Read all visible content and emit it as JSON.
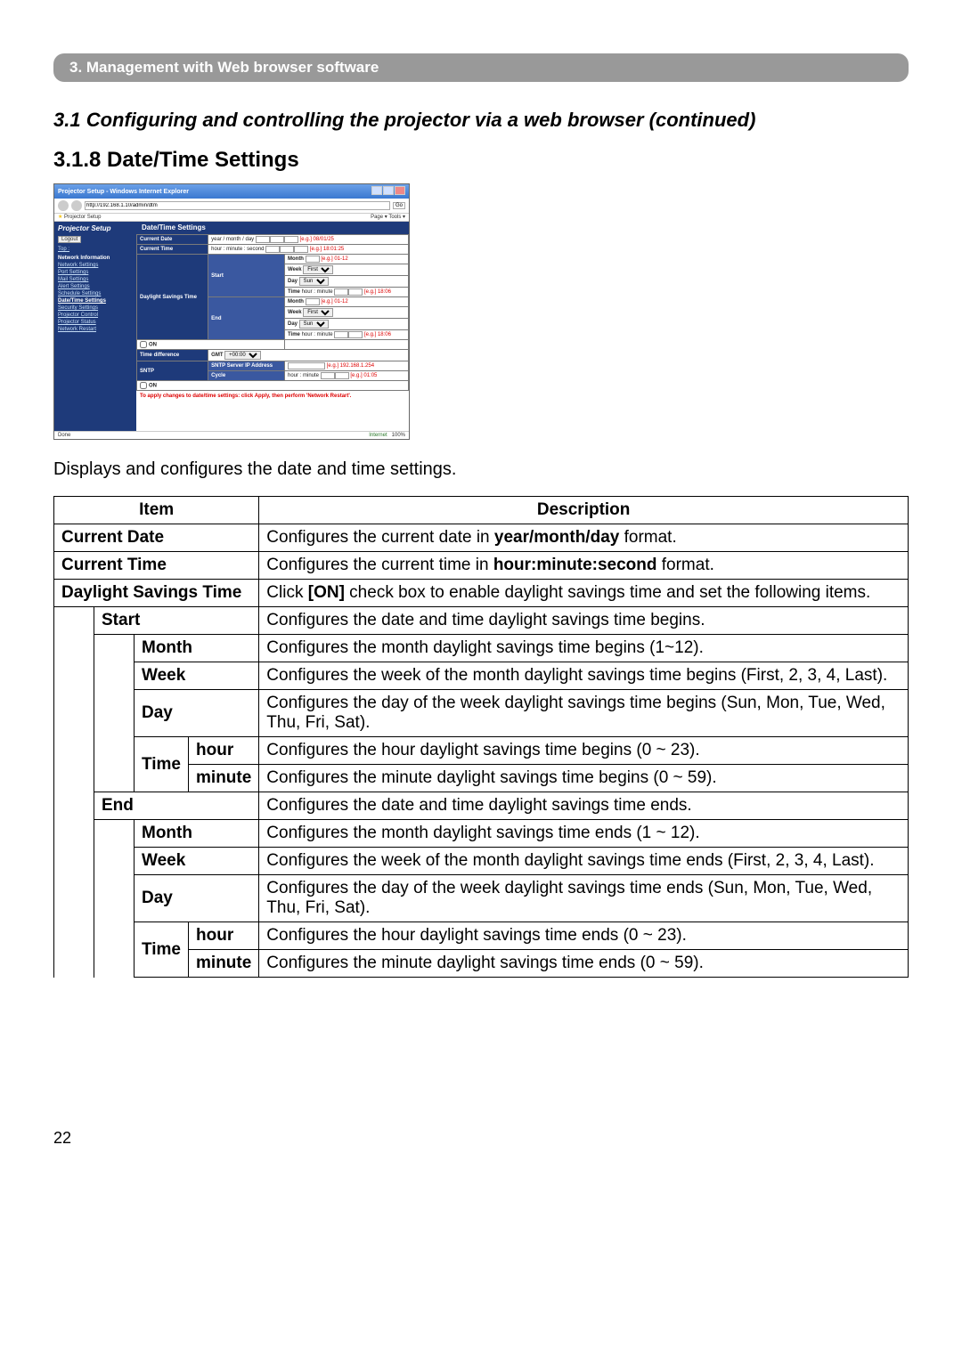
{
  "chapter": "3. Management with Web browser software",
  "section": "3.1 Configuring and controlling the projector via a web browser (continued)",
  "subsection": "3.1.8 Date/Time Settings",
  "intro": "Displays and configures the date and time settings.",
  "pageNumber": "22",
  "screenshot": {
    "title": "Projector Setup - Windows Internet Explorer",
    "url": "http://192.168.1.10/admin/dtm",
    "go": "Go",
    "favlabel": "Projector Setup",
    "cmdbar": "Page ▾  Tools ▾",
    "side_header": "Projector Setup",
    "logout": "Logout",
    "side_top": "Top :",
    "side_net": "Network Information",
    "side_items": [
      "Network Settings",
      "Port Settings",
      "Mail Settings",
      "Alert Settings",
      "Schedule Settings",
      "Date/Time Settings",
      "Security Settings",
      "Projector Control",
      "Projector Status",
      "Network Restart"
    ],
    "main_header": "Date/Time Settings",
    "row_date": "Current Date",
    "row_date_v": "year / month / day",
    "eg_date": "[e.g.] 08/01/25",
    "row_time": "Current Time",
    "row_time_v": "hour : minute : second",
    "eg_time": "[e.g.] 18:01:25",
    "dst": "Daylight Savings Time",
    "on": "ON",
    "start": "Start",
    "end": "End",
    "month": "Month",
    "month_eg": "[e.g.] 01-12",
    "week": "Week",
    "day": "Day",
    "timelbl": "Time",
    "time_v": "hour : minute",
    "time_eg": "[e.g.] 18:06",
    "tdiff": "Time difference",
    "gmt": "GMT",
    "sntp": "SNTP",
    "sntp_ip": "SNTP Server IP Address",
    "cycle": "Cycle",
    "sntp_eg": "[e.g.] 192.168.1.254",
    "cycle_eg": "[e.g.] 01:05",
    "apply_note": "To apply changes to date/time settings: click Apply, then perform 'Network Restart'.",
    "status_done": "Done",
    "status_inet": "Internet",
    "status_zoom": "100%"
  },
  "table": {
    "h_item": "Item",
    "h_desc": "Description",
    "r1i": "Current Date",
    "r1d_a": "Configures the current date in ",
    "r1d_b": "year/month/day",
    "r1d_c": " format.",
    "r2i": "Current Time",
    "r2d_a": "Configures the current time in ",
    "r2d_b": "hour:minute:second",
    "r2d_c": " format.",
    "r3i": "Daylight Savings Time",
    "r3d_a": "Click ",
    "r3d_b": "[ON]",
    "r3d_c": " check box to enable daylight savings time and set the following items.",
    "r4i": "Start",
    "r4d": "Configures the date and time daylight savings time begins.",
    "r5i": "Month",
    "r5d": "Configures the month daylight savings time begins (1~12).",
    "r6i": "Week",
    "r6d": "Configures the week of the month daylight savings time begins (First, 2, 3, 4, Last).",
    "r7i": "Day",
    "r7d": "Configures the day of the week daylight savings time begins (Sun, Mon, Tue, Wed, Thu, Fri, Sat).",
    "r8i": "Time",
    "r8h": "hour",
    "r8d": "Configures the hour daylight savings time begins (0 ~ 23).",
    "r9h": "minute",
    "r9d": "Configures the minute daylight savings time begins (0 ~ 59).",
    "r10i": "End",
    "r10d": "Configures the date and time daylight savings time ends.",
    "r11i": "Month",
    "r11d": "Configures the month daylight savings time ends (1 ~ 12).",
    "r12i": "Week",
    "r12d": "Configures the week of the month daylight savings time ends (First, 2, 3, 4, Last).",
    "r13i": "Day",
    "r13d": "Configures the day of the week daylight savings time ends (Sun, Mon, Tue, Wed, Thu, Fri, Sat).",
    "r14i": "Time",
    "r14h": "hour",
    "r14d": "Configures the hour daylight savings time ends (0 ~ 23).",
    "r15h": "minute",
    "r15d": "Configures the minute daylight savings time ends (0 ~ 59)."
  }
}
